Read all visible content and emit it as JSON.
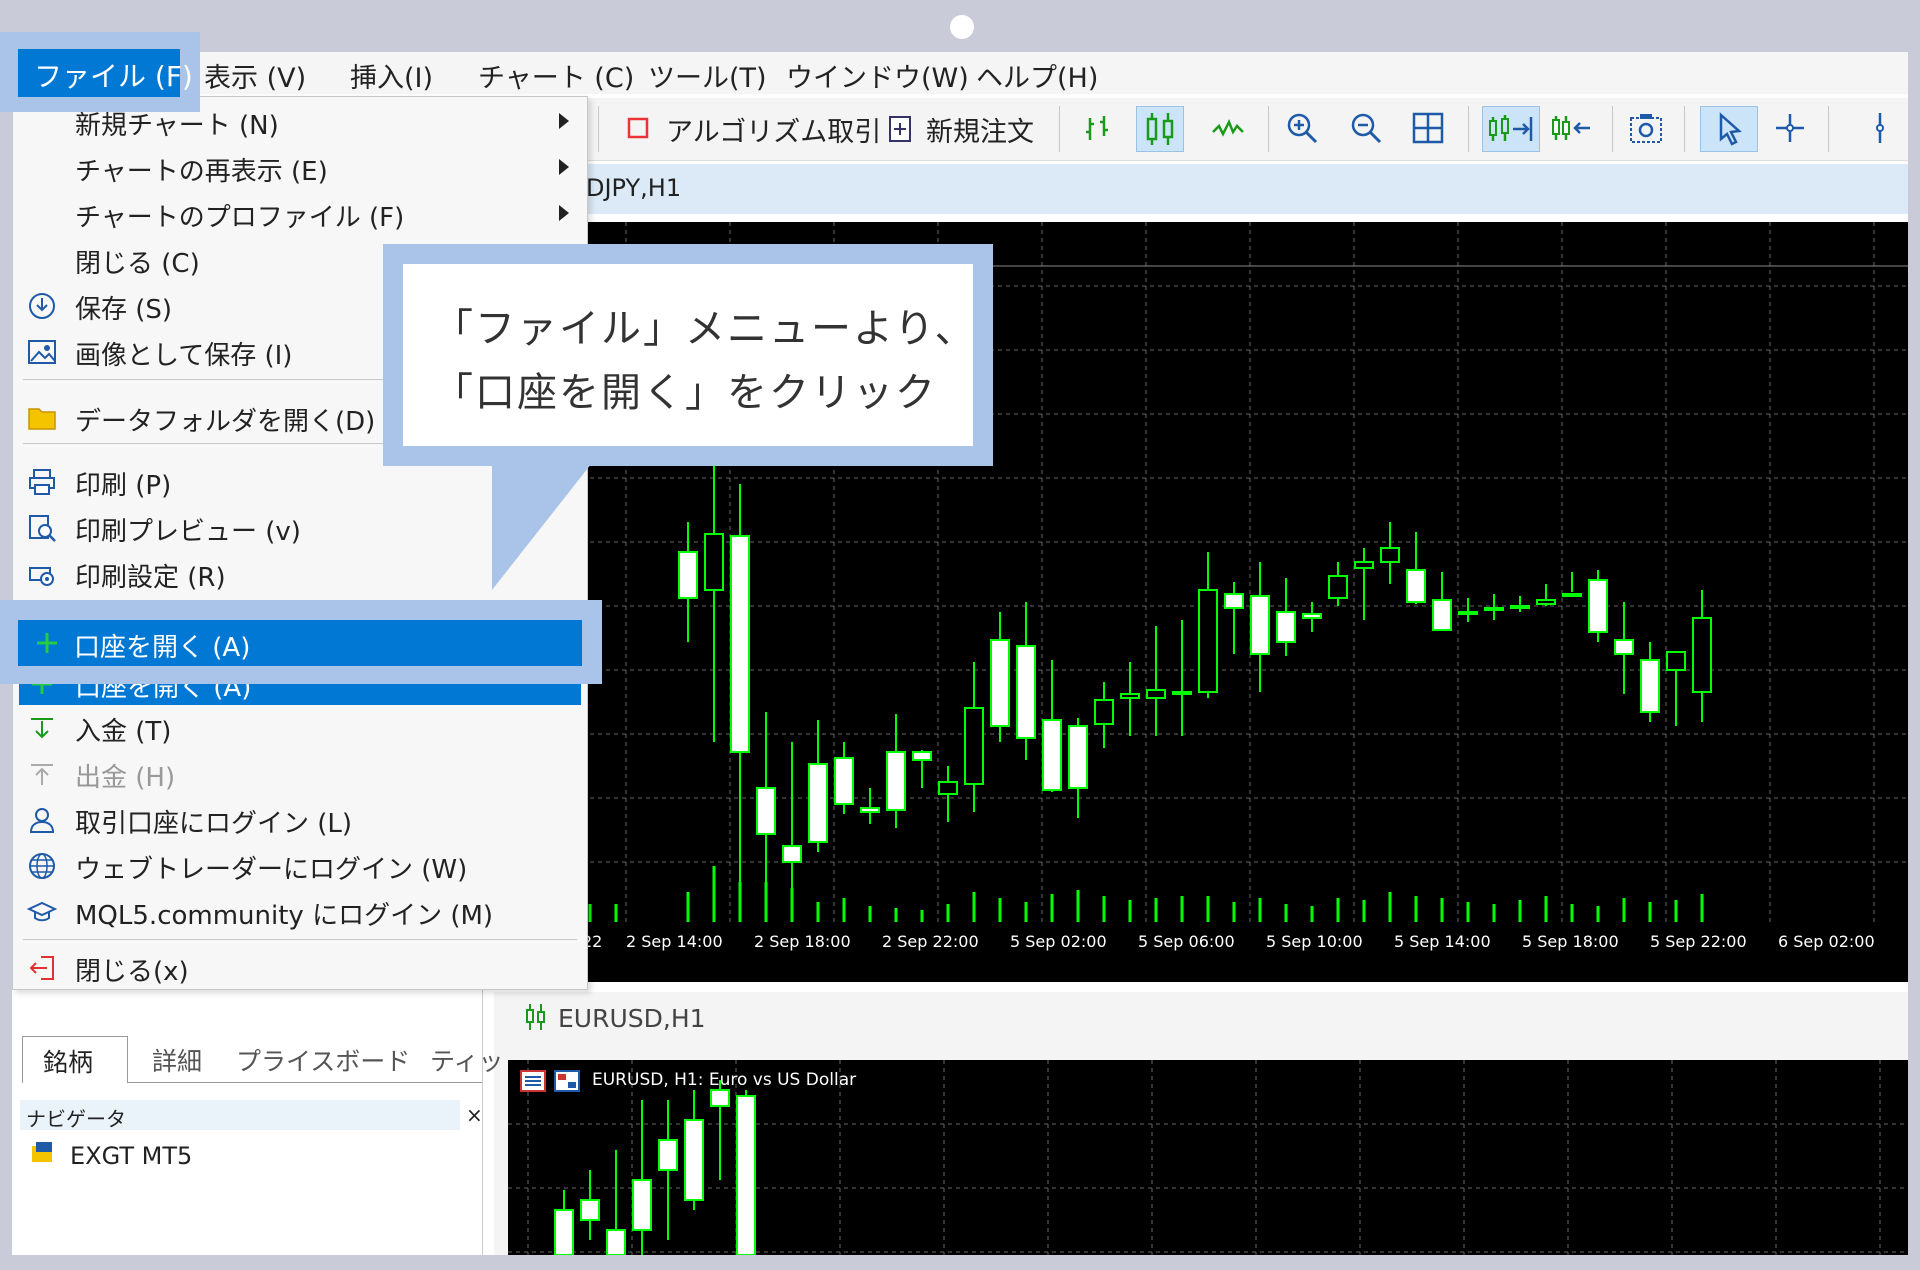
{
  "menubar": {
    "items": [
      {
        "label": "ファイル (F)"
      },
      {
        "label": "表示 (V)"
      },
      {
        "label": "挿入(I)"
      },
      {
        "label": "チャート (C)"
      },
      {
        "label": "ツール(T)"
      },
      {
        "label": "ウインドウ(W)"
      },
      {
        "label": "ヘルプ(H)"
      }
    ]
  },
  "toolbar": {
    "algo_label": "アルゴリズム取引",
    "new_order_label": "新規注文"
  },
  "file_menu": {
    "items": [
      {
        "label": "新規チャート (N)",
        "submenu": true
      },
      {
        "label": "チャートの再表示 (E)",
        "submenu": true
      },
      {
        "label": "チャートのプロファイル (F)",
        "submenu": true
      },
      {
        "label": "閉じる (C)"
      },
      {
        "label": "保存 (S)",
        "icon": "save-icon"
      },
      {
        "label": "画像として保存 (I)",
        "icon": "image-icon"
      },
      {
        "label": "データフォルダを開く(D)",
        "icon": "folder-icon"
      },
      {
        "label": "印刷 (P)",
        "icon": "printer-icon"
      },
      {
        "label": "印刷プレビュー (v)",
        "icon": "print-preview-icon"
      },
      {
        "label": "印刷設定 (R)",
        "icon": "print-settings-icon"
      },
      {
        "label": "口座を開く (A)",
        "icon": "plus-icon",
        "highlighted": true
      },
      {
        "label": "入金 (T)",
        "icon": "deposit-icon"
      },
      {
        "label": "出金 (H)",
        "icon": "withdraw-icon",
        "disabled": true
      },
      {
        "label": "取引口座にログイン (L)",
        "icon": "user-icon"
      },
      {
        "label": "ウェブトレーダーにログイン (W)",
        "icon": "globe-icon"
      },
      {
        "label": "MQL5.community にログイン (M)",
        "icon": "graduation-cap-icon"
      },
      {
        "label": "閉じる(x)",
        "icon": "exit-icon"
      }
    ]
  },
  "callout": {
    "line1": "「ファイル」メニューより、",
    "line2": "「口座を開く」をクリック"
  },
  "chart1": {
    "title": "DJPY,H1",
    "time_labels": [
      "22",
      "2 Sep 14:00",
      "2 Sep 18:00",
      "2 Sep 22:00",
      "5 Sep 02:00",
      "5 Sep 06:00",
      "5 Sep 10:00",
      "5 Sep 14:00",
      "5 Sep 18:00",
      "5 Sep 22:00",
      "6 Sep 02:00"
    ]
  },
  "chart2": {
    "title": "EURUSD,H1",
    "legend": "EURUSD, H1:  Euro vs US Dollar"
  },
  "left_panel": {
    "tabs": [
      "銘柄",
      "詳細",
      "プライスボード",
      "ティッ"
    ],
    "navigator_title": "ナビゲータ",
    "navigator_close": "×",
    "tree_root": "EXGT MT5"
  },
  "colors": {
    "accent": "#0078d4",
    "highlight_frame": "#a9c4e8",
    "bull_candle": "#00ff00",
    "bear_candle": "#ffffff",
    "chart_bg": "#000000"
  }
}
